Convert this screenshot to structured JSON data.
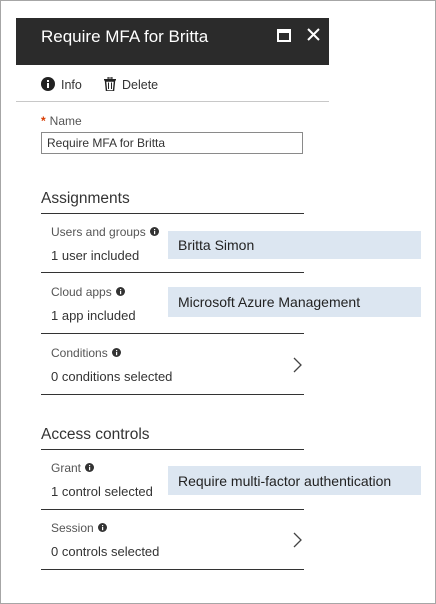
{
  "blade": {
    "title": "Require MFA for Britta",
    "controls": {
      "maximize_icon": "maximize-icon",
      "close_icon": "close-icon"
    }
  },
  "toolbar": {
    "info_label": "Info",
    "delete_label": "Delete"
  },
  "name_field": {
    "required_marker": "*",
    "label": "Name",
    "value": "Require MFA for Britta"
  },
  "assignments": {
    "heading": "Assignments",
    "users_groups": {
      "label": "Users and groups",
      "value": "1 user included"
    },
    "cloud_apps": {
      "label": "Cloud apps",
      "value": "1 app included"
    },
    "conditions": {
      "label": "Conditions",
      "value": "0 conditions selected"
    }
  },
  "access_controls": {
    "heading": "Access controls",
    "grant": {
      "label": "Grant",
      "value": "1 control selected"
    },
    "session": {
      "label": "Session",
      "value": "0 controls selected"
    }
  },
  "callouts": {
    "users": "Britta Simon",
    "apps": "Microsoft Azure Management",
    "grant": "Require multi-factor authentication"
  },
  "colors": {
    "titlebar_bg": "#2b2b2b",
    "required_star": "#d83b01",
    "callout_bg": "#dce6f1"
  }
}
